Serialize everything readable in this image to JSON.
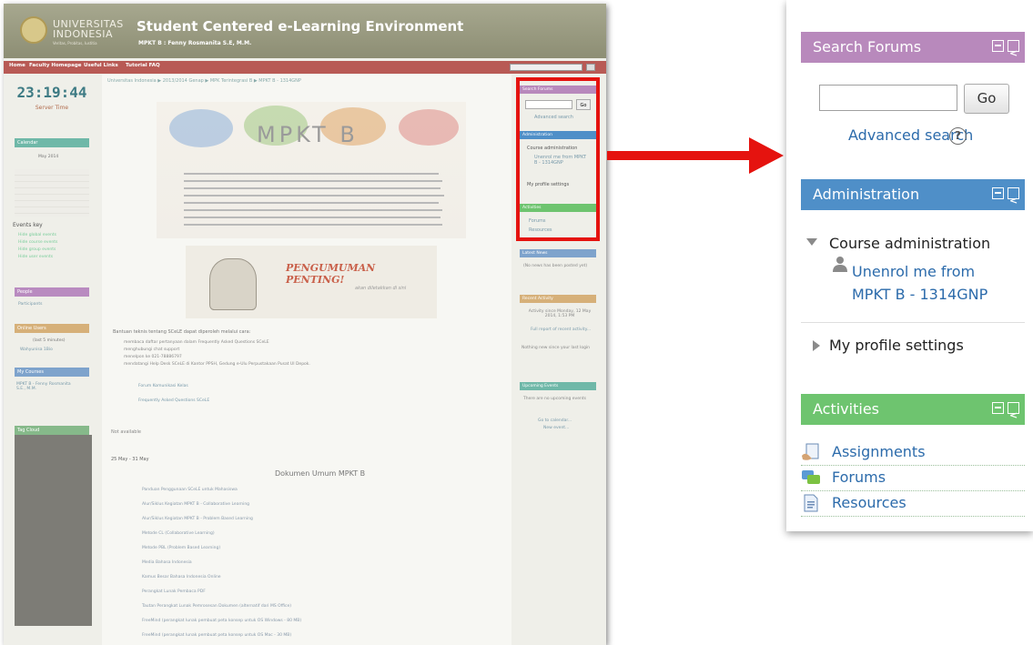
{
  "screenshot": {
    "banner": {
      "university_name": "UNIVERSITAS INDONESIA",
      "tagline": "Veritas, Probitas, Iustitia",
      "site_title": "Student Centered e-Learning Environment",
      "course_subtitle": "MPKT B : Fenny Rosmanita S.E, M.M."
    },
    "nav": {
      "items": [
        "Home",
        "Faculty Homepage",
        "Useful Links",
        "Tutorial FAQ"
      ]
    },
    "left": {
      "clock": "23:19:44",
      "server_time_label": "Server Time",
      "calendar_header": "Calendar",
      "calendar_month": "May 2014",
      "events_key_label": "Events key",
      "events_key": [
        "Hide global events",
        "Hide course events",
        "Hide group events",
        "Hide user events"
      ],
      "people_header": "People",
      "participants": "Participants",
      "online_users_header": "Online Users",
      "online_window": "(last 5 minutes)",
      "online_user": "Wahyunisa 1Bio",
      "my_courses_header": "My Courses",
      "my_course": "MPKT B - Fenny Rosmanita S.E., M.M.",
      "tag_header": "Tag Cloud"
    },
    "center": {
      "breadcrumb": "Universitas Indonesia ▶ 2013/2014 Genap ▶ MPK Terintegrasi B ▶ MPKT B - 1314GNP",
      "logo_text": "MPKT B",
      "announcement_title": "PENGUMUMAN PENTING!",
      "announcement_sub": "akan diletakkan di sini",
      "support_intro": "Bantuan teknis tentang SCeLE dapat diperoleh melalui cara:",
      "support_items": [
        "membaca daftar pertanyaan dalam Frequently Asked Questions SCeLE",
        "menghubungi chat support",
        "menelpon ke 021-78886797",
        "mendatangi Help Desk SCeLE di Kantor PPSH, Gedung e-Ulu Perpustakaan Pusat UI Depok."
      ],
      "forum_link": "Forum Komunikasi Kelas",
      "faq_link": "Frequently Asked Questions SCeLE",
      "not_available": "Not available",
      "week": "25 May - 31 May",
      "docs_title": "Dokumen Umum MPKT B",
      "docs": [
        "Panduan Penggunaan SCeLE untuk Mahasiswa",
        "Alur/Siklus Kegiatan MPKT B - Collaborative Learning",
        "Alur/Siklus Kegiatan MPKT B - Problem Based Learning",
        "Metode CL (Collaborative Learning)",
        "Metode PBL (Problem Based Learning)",
        "Media Bahasa Indonesia",
        "Kamus Besar Bahasa Indonesia Online",
        "Perangkat Lunak Pembaca PDF",
        "Tautan Perangkat Lunak Pemrosesan Dokumen (alternatif dari MS Office)",
        "FreeMind (perangkat lunak pembuat peta konsep untuk OS Windows - 80 MB)",
        "FreeMind (perangkat lunak pembuat peta konsep untuk OS Mac - 30 MB)"
      ]
    },
    "right": {
      "search_header": "Search Forums",
      "go": "Go",
      "advanced": "Advanced search",
      "admin_header": "Administration",
      "course_admin": "Course administration",
      "unenrol": "Unenrol me from MPKT B - 1314GNP",
      "profile": "My profile settings",
      "activities_header": "Activities",
      "forums": "Forums",
      "resources": "Resources",
      "latest_news_header": "Latest News",
      "latest_news_text": "(No news has been posted yet)",
      "recent_header": "Recent Activity",
      "recent_since": "Activity since Monday, 12 May 2014, 1:53 PM",
      "recent_full": "Full report of recent activity...",
      "recent_nothing": "Nothing new since your last login",
      "upcoming_header": "Upcoming Events",
      "upcoming_text": "There are no upcoming events",
      "go_calendar": "Go to calendar...",
      "new_event": "New event..."
    }
  },
  "zoom": {
    "search": {
      "header": "Search Forums",
      "input_value": "",
      "go_label": "Go",
      "advanced_label": "Advanced search"
    },
    "admin": {
      "header": "Administration",
      "course_admin": "Course administration",
      "unenrol_line1": "Unenrol me from",
      "unenrol_line2": "MPKT B - 1314GNP",
      "profile": "My profile settings"
    },
    "activities": {
      "header": "Activities",
      "items": [
        "Assignments",
        "Forums",
        "Resources"
      ]
    }
  },
  "colors": {
    "search_header": "#b889bc",
    "admin_header": "#4f8fc8",
    "activities_header": "#6ec46f",
    "link": "#2c6bab",
    "highlight": "#e5130f",
    "nav_bar": "#b85a55"
  },
  "icons": [
    "minimize-icon",
    "dock-icon",
    "help-icon",
    "user-icon",
    "assignment-icon",
    "forum-icon",
    "resource-icon",
    "arrow-icon"
  ]
}
